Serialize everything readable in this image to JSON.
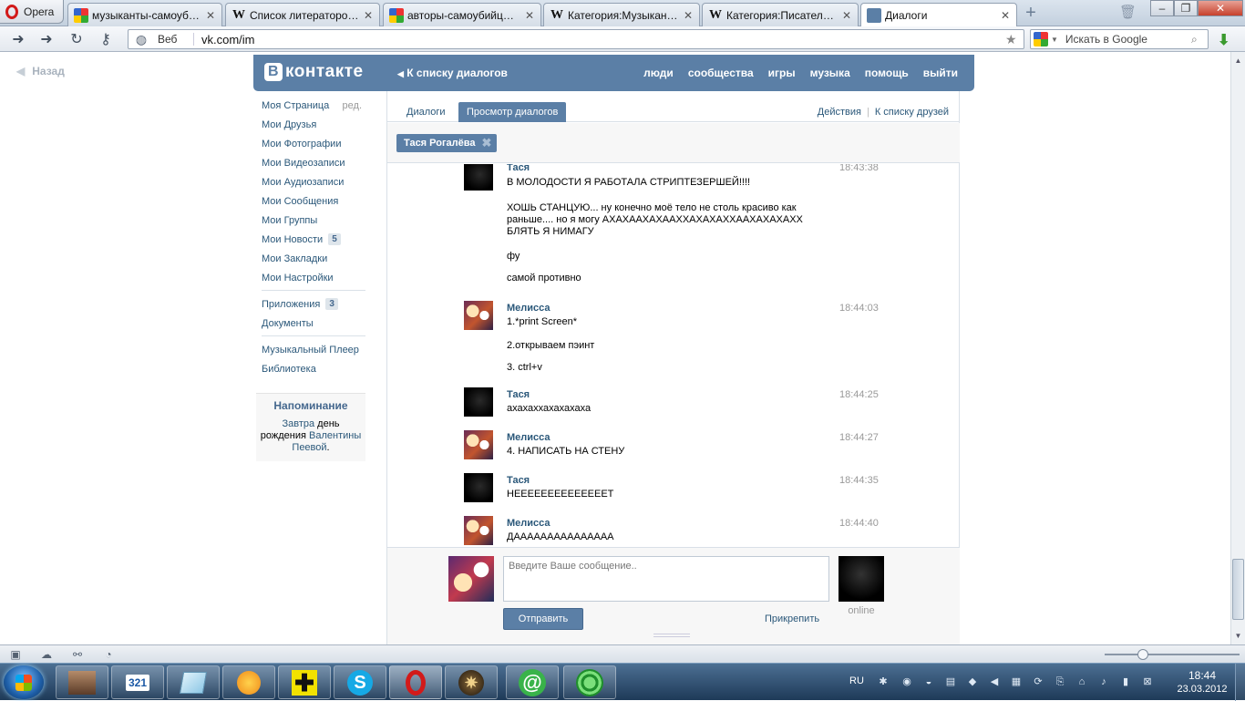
{
  "browser": {
    "menu_label": "Opera",
    "tabs": [
      {
        "title": "музыканты-самоубий...",
        "favicon": "google-icon",
        "active": false
      },
      {
        "title": "Список литераторов-...",
        "favicon": "wikipedia-icon",
        "active": false
      },
      {
        "title": "авторы-самоубийцы ...",
        "favicon": "google-icon",
        "active": false
      },
      {
        "title": "Категория:Музыканты...",
        "favicon": "wikipedia-icon",
        "active": false
      },
      {
        "title": "Категория:Писатели-с...",
        "favicon": "wikipedia-icon",
        "active": false
      },
      {
        "title": "Диалоги",
        "favicon": "vk-icon",
        "active": true
      }
    ],
    "address": {
      "mode_label": "Веб",
      "url": "vk.com/im"
    },
    "search_placeholder": "Искать в Google"
  },
  "page": {
    "back_label": "Назад",
    "header": {
      "logo": "контакте",
      "logo_badge": "В",
      "back_link": "К списку диалогов",
      "nav": [
        "люди",
        "сообщества",
        "игры",
        "музыка",
        "помощь",
        "выйти"
      ]
    },
    "menu": {
      "edit_label": "ред.",
      "group1": [
        {
          "label": "Моя Страница",
          "badge": ""
        },
        {
          "label": "Мои Друзья",
          "badge": ""
        },
        {
          "label": "Мои Фотографии",
          "badge": ""
        },
        {
          "label": "Мои Видеозаписи",
          "badge": ""
        },
        {
          "label": "Мои Аудиозаписи",
          "badge": ""
        },
        {
          "label": "Мои Сообщения",
          "badge": ""
        },
        {
          "label": "Мои Группы",
          "badge": ""
        },
        {
          "label": "Мои Новости",
          "badge": "5"
        },
        {
          "label": "Мои Закладки",
          "badge": ""
        },
        {
          "label": "Мои Настройки",
          "badge": ""
        }
      ],
      "group2": [
        {
          "label": "Приложения",
          "badge": "3"
        },
        {
          "label": "Документы",
          "badge": ""
        }
      ],
      "group3": [
        {
          "label": "Музыкальный Плеер",
          "badge": ""
        },
        {
          "label": "Библиотека",
          "badge": ""
        }
      ]
    },
    "reminder": {
      "title": "Напоминание",
      "link_tomorrow": "Завтра",
      "text_mid": "день рождения",
      "link_name": "Валентины Пеевой",
      "text_end": "."
    },
    "tabs": {
      "dialogs": "Диалоги",
      "view": "Просмотр диалогов",
      "actions": "Действия",
      "separator": "|",
      "friends_list": "К списку друзей"
    },
    "filter_chip": "Тася Рогалёва",
    "messages": [
      {
        "author": "Тася",
        "avatar": "tasya",
        "time": "18:43:38",
        "lines": [
          "В МОЛОДОСТИ Я РАБОТАЛА СТРИПТЕЗЕРШЕЙ!!!!",
          "ХОШЬ СТАНЦУЮ... ну конечно моё тело не столь красиво как раньше.... но я могу АХАХААХАХААХХАХАХАХХААХАХАХАХХ БЛЯТЬ Я НИМАГУ",
          "фу",
          "самой противно"
        ]
      },
      {
        "author": "Мелисса",
        "avatar": "melissa",
        "time": "18:44:03",
        "lines": [
          "1.*print Screen*",
          "2.открываем пэинт",
          "3. ctrl+v"
        ]
      },
      {
        "author": "Тася",
        "avatar": "tasya",
        "time": "18:44:25",
        "lines": [
          "ахахаххахахахаха"
        ]
      },
      {
        "author": "Мелисса",
        "avatar": "melissa",
        "time": "18:44:27",
        "lines": [
          "4. НАПИСАТЬ НА СТЕНУ"
        ]
      },
      {
        "author": "Тася",
        "avatar": "tasya",
        "time": "18:44:35",
        "lines": [
          "НЕЕЕЕЕЕЕЕЕЕЕЕЕЕТ"
        ]
      },
      {
        "author": "Мелисса",
        "avatar": "melissa",
        "time": "18:44:40",
        "lines": [
          "ДААААААААААААААА"
        ]
      }
    ],
    "composer": {
      "placeholder": "Введите Ваше сообщение..",
      "send": "Отправить",
      "attach": "Прикрепить",
      "status": "online"
    }
  },
  "taskbar": {
    "apps": [
      "media-player-icon",
      "total-commander-icon",
      "notepad-icon",
      "aimp-icon",
      "plus-icon",
      "skype-icon",
      "opera-icon",
      "game-icon",
      "mail-agent-icon",
      "icq-icon"
    ],
    "app_glyph_321": "321",
    "language": "RU",
    "time": "18:44",
    "date": "23.03.2012"
  },
  "colors": {
    "vk_blue": "#5b7fa6",
    "vk_link": "#2b587a",
    "taskbar": "#1e3a58"
  }
}
